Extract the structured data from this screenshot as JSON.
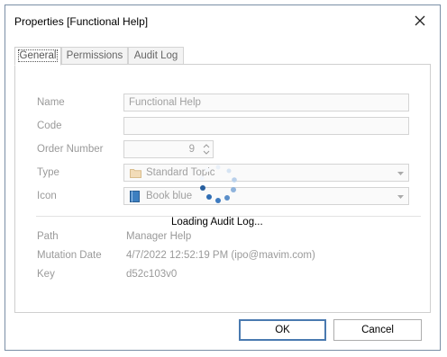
{
  "window": {
    "title": "Properties [Functional Help]"
  },
  "tabs": [
    {
      "label": "General"
    },
    {
      "label": "Permissions"
    },
    {
      "label": "Audit Log"
    }
  ],
  "form": {
    "name_label": "Name",
    "name_value": "Functional Help",
    "code_label": "Code",
    "code_value": "",
    "order_label": "Order Number",
    "order_value": "9",
    "type_label": "Type",
    "type_value": "Standard Topic",
    "icon_label": "Icon",
    "icon_value": "Book blue"
  },
  "info": {
    "path_label": "Path",
    "path_value": "Manager Help",
    "mutation_label": "Mutation Date",
    "mutation_value": "4/7/2022 12:52:19 PM (ipo@mavim.com)",
    "key_label": "Key",
    "key_value": "d52c103v0"
  },
  "loading": {
    "text": "Loading Audit Log..."
  },
  "buttons": {
    "ok_label": "OK",
    "cancel_label": "Cancel"
  },
  "icons": {
    "close": "close-icon",
    "type": "folder-icon",
    "icon": "book-icon",
    "spinner": "loading-spinner-icon"
  },
  "colors": {
    "accent": "#2f6db3",
    "border": "#7a8fa6"
  }
}
